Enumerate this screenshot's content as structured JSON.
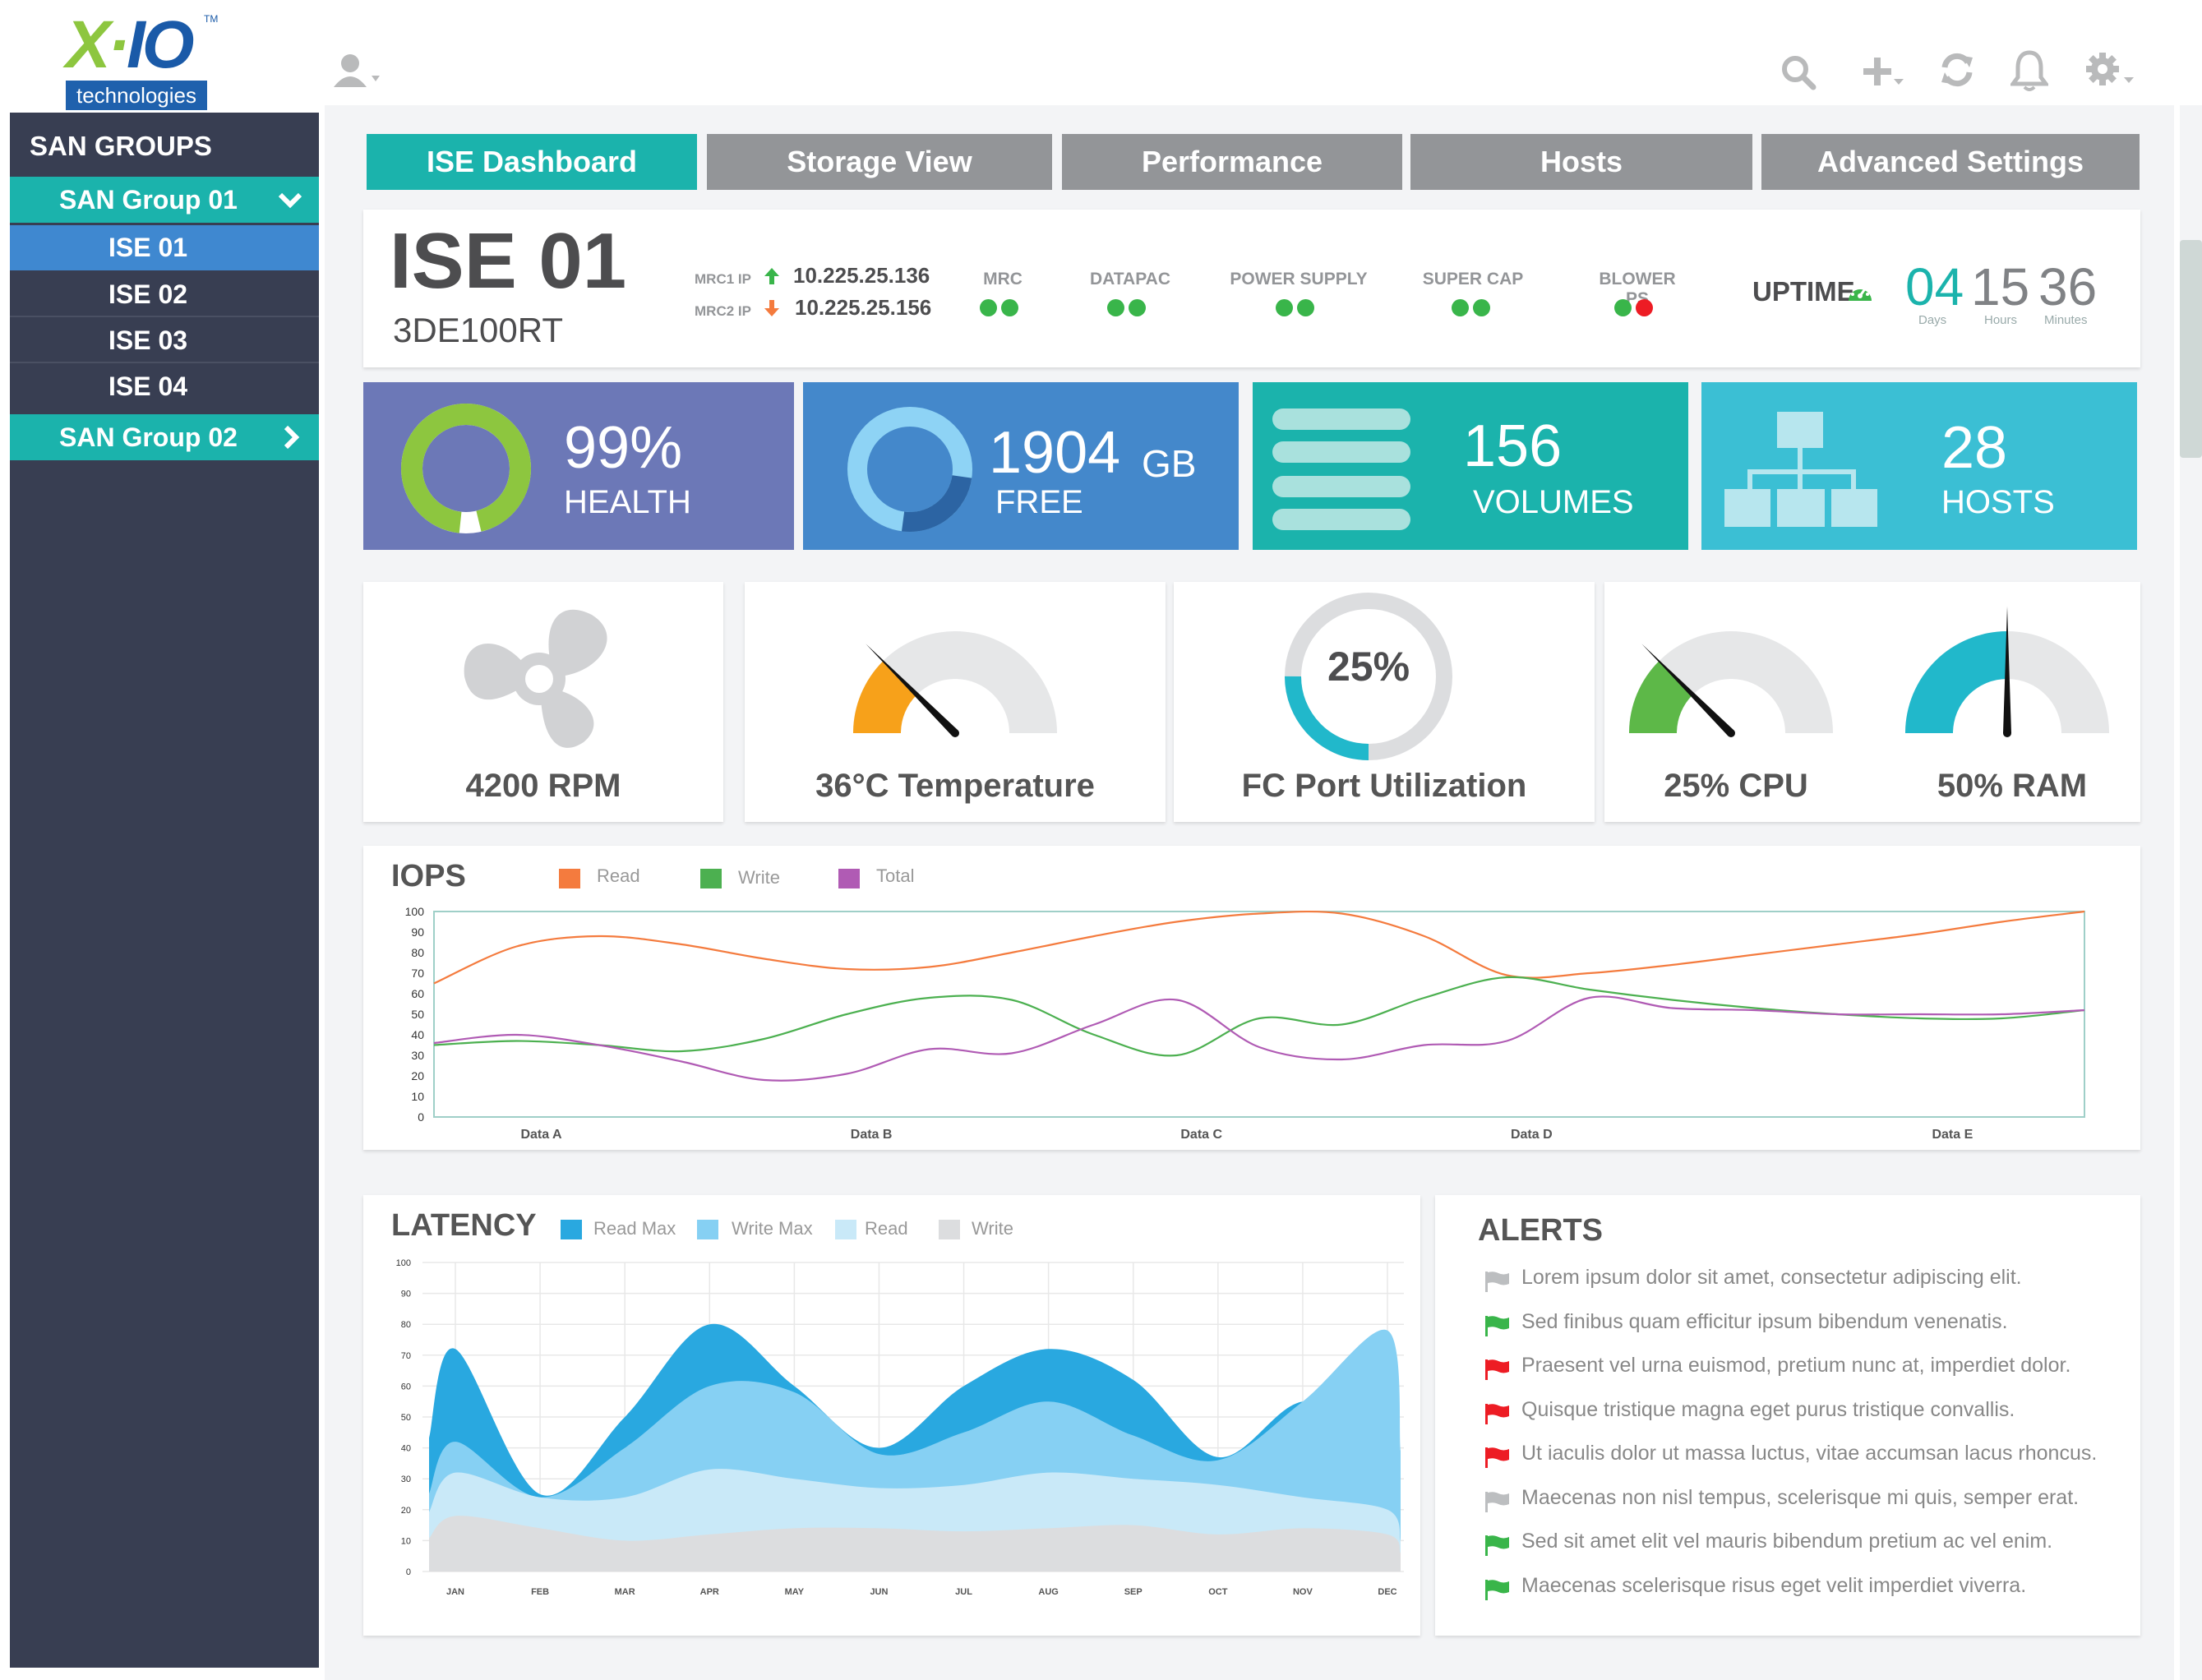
{
  "brand": {
    "logo_text_left": "X",
    "logo_text_right": "IO",
    "logo_tm": "TM",
    "logo_sub": "technologies"
  },
  "toolbar_icons": [
    "user-icon",
    "search-icon",
    "add-icon",
    "refresh-icon",
    "bell-icon",
    "gear-icon"
  ],
  "sidebar": {
    "heading": "SAN GROUPS",
    "groups": [
      {
        "label": "SAN Group 01",
        "chevron": "expanded",
        "items": [
          "ISE 01",
          "ISE 02",
          "ISE 03",
          "ISE 04"
        ],
        "active_item": "ISE 01"
      },
      {
        "label": "SAN Group 02",
        "chevron": "collapsed"
      }
    ]
  },
  "tabs": [
    "ISE Dashboard",
    "Storage View",
    "Performance",
    "Hosts",
    "Advanced Settings"
  ],
  "active_tab": "ISE Dashboard",
  "device": {
    "name": "ISE 01",
    "serial": "3DE100RT",
    "mrc1_label": "MRC1 IP",
    "mrc1_ip": "10.225.25.136",
    "mrc2_label": "MRC2 IP",
    "mrc2_ip": "10.225.25.156",
    "statuses": [
      {
        "label": "MRC",
        "dots": [
          "#39b54a",
          "#39b54a"
        ]
      },
      {
        "label": "DATAPAC",
        "dots": [
          "#39b54a",
          "#39b54a"
        ]
      },
      {
        "label": "POWER SUPPLY",
        "dots": [
          "#39b54a",
          "#39b54a"
        ]
      },
      {
        "label": "SUPER CAP",
        "dots": [
          "#39b54a",
          "#39b54a"
        ]
      },
      {
        "label": "BLOWER PS",
        "dots": [
          "#39b54a",
          "#ed1c24"
        ]
      }
    ],
    "uptime_label": "UPTIME",
    "uptime": {
      "days": "04",
      "hours": "15",
      "minutes": "36",
      "days_label": "Days",
      "hours_label": "Hours",
      "minutes_label": "Minutes"
    }
  },
  "tiles": [
    {
      "value": "99%",
      "label": "HEALTH",
      "color": "#6c78b7",
      "ring_fraction": 0.99
    },
    {
      "value": "1904",
      "unit": "GB",
      "label": "FREE",
      "color": "#4488cb"
    },
    {
      "value": "156",
      "label": "VOLUMES",
      "color": "#1bb3ac"
    },
    {
      "value": "28",
      "label": "HOSTS",
      "color": "#3bbfd4"
    }
  ],
  "gauges": {
    "fan": "4200 RPM",
    "temperature": "36°C Temperature",
    "fc_port_value": "25%",
    "fc_port_label": "FC Port Utilization",
    "fc_port_fraction": 0.25,
    "cpu": "25% CPU",
    "cpu_fraction": 0.25,
    "ram": "50% RAM",
    "ram_fraction": 0.5,
    "temp_fraction": 0.25
  },
  "iops": {
    "title": "IOPS",
    "legend": [
      {
        "name": "Read",
        "color": "#f47b3e"
      },
      {
        "name": "Write",
        "color": "#4cb050"
      },
      {
        "name": "Total",
        "color": "#b05bb4"
      }
    ]
  },
  "latency": {
    "title": "LATENCY",
    "legend": [
      {
        "name": "Read Max",
        "color": "#29a8e0"
      },
      {
        "name": "Write Max",
        "color": "#86d0f3"
      },
      {
        "name": "Read",
        "color": "#c9e9f8"
      },
      {
        "name": "Write",
        "color": "#dcdddf"
      }
    ]
  },
  "alerts": {
    "title": "ALERTS",
    "items": [
      {
        "text": "Lorem ipsum dolor sit amet, consectetur adipiscing elit.",
        "color": "#bcbec0"
      },
      {
        "text": "Sed finibus quam efficitur ipsum bibendum venenatis.",
        "color": "#39b54a"
      },
      {
        "text": "Praesent vel urna euismod, pretium nunc at, imperdiet dolor.",
        "color": "#ed1c24"
      },
      {
        "text": "Quisque tristique magna eget purus tristique convallis.",
        "color": "#ed1c24"
      },
      {
        "text": "Ut iaculis dolor ut massa luctus, vitae accumsan lacus rhoncus.",
        "color": "#ed1c24"
      },
      {
        "text": "Maecenas non nisl tempus, scelerisque mi quis, semper erat.",
        "color": "#bcbec0"
      },
      {
        "text": "Sed sit amet elit vel mauris bibendum pretium ac vel enim.",
        "color": "#39b54a"
      },
      {
        "text": "Maecenas scelerisque risus eget velit imperdiet viverra.",
        "color": "#39b54a"
      }
    ]
  },
  "chart_data": [
    {
      "type": "line",
      "title": "IOPS",
      "categories": [
        "Data A",
        "Data B",
        "Data C",
        "Data D",
        "Data E"
      ],
      "ylim": [
        0,
        100
      ],
      "yticks": [
        0,
        10,
        20,
        30,
        40,
        50,
        60,
        70,
        80,
        90,
        100
      ],
      "x": [
        0,
        0.5,
        1,
        1.5,
        2,
        2.5,
        3,
        3.5,
        4,
        4.5,
        5,
        5.5,
        6,
        6.5,
        7,
        7.5,
        8,
        8.5,
        9,
        9.5,
        10
      ],
      "series": [
        {
          "name": "Read",
          "values": [
            65,
            83,
            88,
            84,
            77,
            72,
            73,
            80,
            88,
            95,
            99,
            99,
            88,
            69,
            70,
            74,
            79,
            84,
            89,
            95,
            100
          ]
        },
        {
          "name": "Write",
          "values": [
            35,
            37,
            35,
            32,
            38,
            50,
            58,
            57,
            40,
            30,
            48,
            45,
            58,
            68,
            62,
            57,
            53,
            50,
            48,
            48,
            52
          ]
        },
        {
          "name": "Total",
          "values": [
            36,
            40,
            35,
            27,
            18,
            21,
            33,
            31,
            45,
            57,
            34,
            28,
            35,
            37,
            58,
            53,
            52,
            50,
            50,
            50,
            52
          ]
        }
      ]
    },
    {
      "type": "area",
      "title": "LATENCY",
      "categories": [
        "JAN",
        "FEB",
        "MAR",
        "APR",
        "MAY",
        "JUN",
        "JUL",
        "AUG",
        "SEP",
        "OCT",
        "NOV",
        "DEC"
      ],
      "ylim": [
        0,
        100
      ],
      "yticks": [
        0,
        10,
        20,
        30,
        40,
        50,
        60,
        70,
        80,
        90,
        100
      ],
      "series": [
        {
          "name": "Read Max",
          "values": [
            72,
            25,
            50,
            80,
            60,
            40,
            60,
            72,
            62,
            37,
            55,
            45
          ]
        },
        {
          "name": "Write Max",
          "values": [
            42,
            24,
            40,
            60,
            58,
            38,
            45,
            55,
            44,
            36,
            55,
            78
          ]
        },
        {
          "name": "Read",
          "values": [
            32,
            24,
            24,
            33,
            30,
            27,
            28,
            32,
            30,
            28,
            24,
            20
          ]
        },
        {
          "name": "Write",
          "values": [
            18,
            14,
            10,
            12,
            14,
            14,
            13,
            14,
            15,
            12,
            14,
            12
          ]
        }
      ]
    }
  ]
}
